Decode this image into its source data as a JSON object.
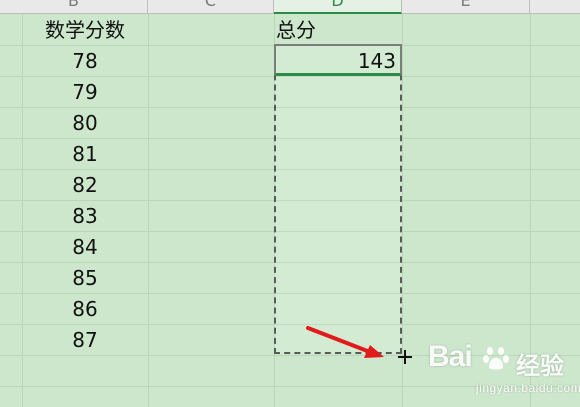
{
  "spreadsheet": {
    "column_headers": {
      "b": "B",
      "c": "C",
      "d": "D",
      "e": "E"
    },
    "math_scores": {
      "header": "数学分数",
      "values": [
        "78",
        "79",
        "80",
        "81",
        "82",
        "83",
        "84",
        "85",
        "86",
        "87"
      ]
    },
    "total": {
      "header": "总分",
      "value": "143"
    }
  },
  "colors": {
    "sheet_background": "#cde7cd",
    "active_header": "#2e8b46",
    "annotation_arrow": "#e11b1b"
  },
  "icons": {
    "fill_handle_cursor": "crosshair-plus-icon",
    "annotation": "red-arrow-icon"
  },
  "watermark": {
    "brand": "Bai",
    "suffix": "经验",
    "domain": "jingyan.baidu.com"
  }
}
